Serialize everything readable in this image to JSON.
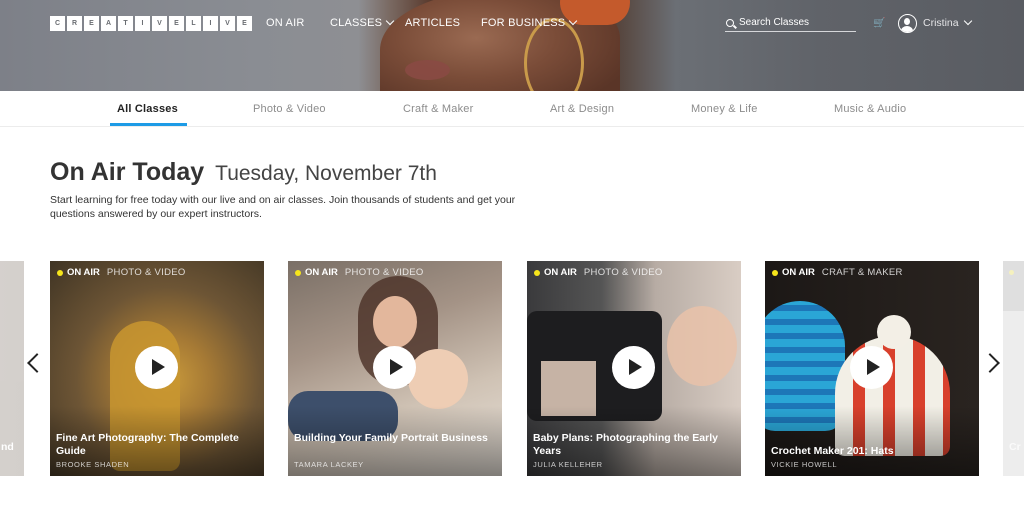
{
  "header": {
    "logo_letters": [
      "C",
      "R",
      "E",
      "A",
      "T",
      "I",
      "V",
      "E",
      "L",
      "I",
      "V",
      "E"
    ],
    "nav": [
      {
        "label": "ON AIR",
        "has_dropdown": false
      },
      {
        "label": "CLASSES",
        "has_dropdown": true
      },
      {
        "label": "ARTICLES",
        "has_dropdown": false
      },
      {
        "label": "FOR BUSINESS",
        "has_dropdown": true
      }
    ],
    "search": {
      "placeholder": "Search Classes",
      "value": ""
    },
    "cart_icon": "shopping-cart-icon",
    "user": {
      "name": "Cristina",
      "avatar_icon": "user-avatar-icon"
    }
  },
  "tabs": {
    "active": "All Classes",
    "items": [
      "All Classes",
      "Photo & Video",
      "Craft & Maker",
      "Art & Design",
      "Money & Life",
      "Music & Audio"
    ],
    "accent_color": "#1d9be6"
  },
  "intro": {
    "title": "On Air Today",
    "date": "Tuesday, November 7th",
    "description": "Start learning for free today with our live and on air classes. Join thousands of students and get your questions answered by our expert instructors."
  },
  "carousel": {
    "status_label": "ON AIR",
    "status_color": "#f6e51b",
    "cards": [
      {
        "category": "PHOTO & VIDEO",
        "title": "Fine Art Photography: The Complete Guide",
        "author": "BROOKE SHADEN"
      },
      {
        "category": "PHOTO & VIDEO",
        "title": "Building Your Family Portrait Business",
        "author": "TAMARA LACKEY"
      },
      {
        "category": "PHOTO & VIDEO",
        "title": "Baby Plans: Photographing the Early Years",
        "author": "JULIA KELLEHER"
      },
      {
        "category": "CRAFT & MAKER",
        "title": "Crochet Maker 201: Hats",
        "author": "VICKIE HOWELL"
      }
    ],
    "partial_left_title": "nd",
    "partial_right_title": "Cr",
    "prev_icon": "chevron-left-icon",
    "next_icon": "chevron-right-icon"
  }
}
